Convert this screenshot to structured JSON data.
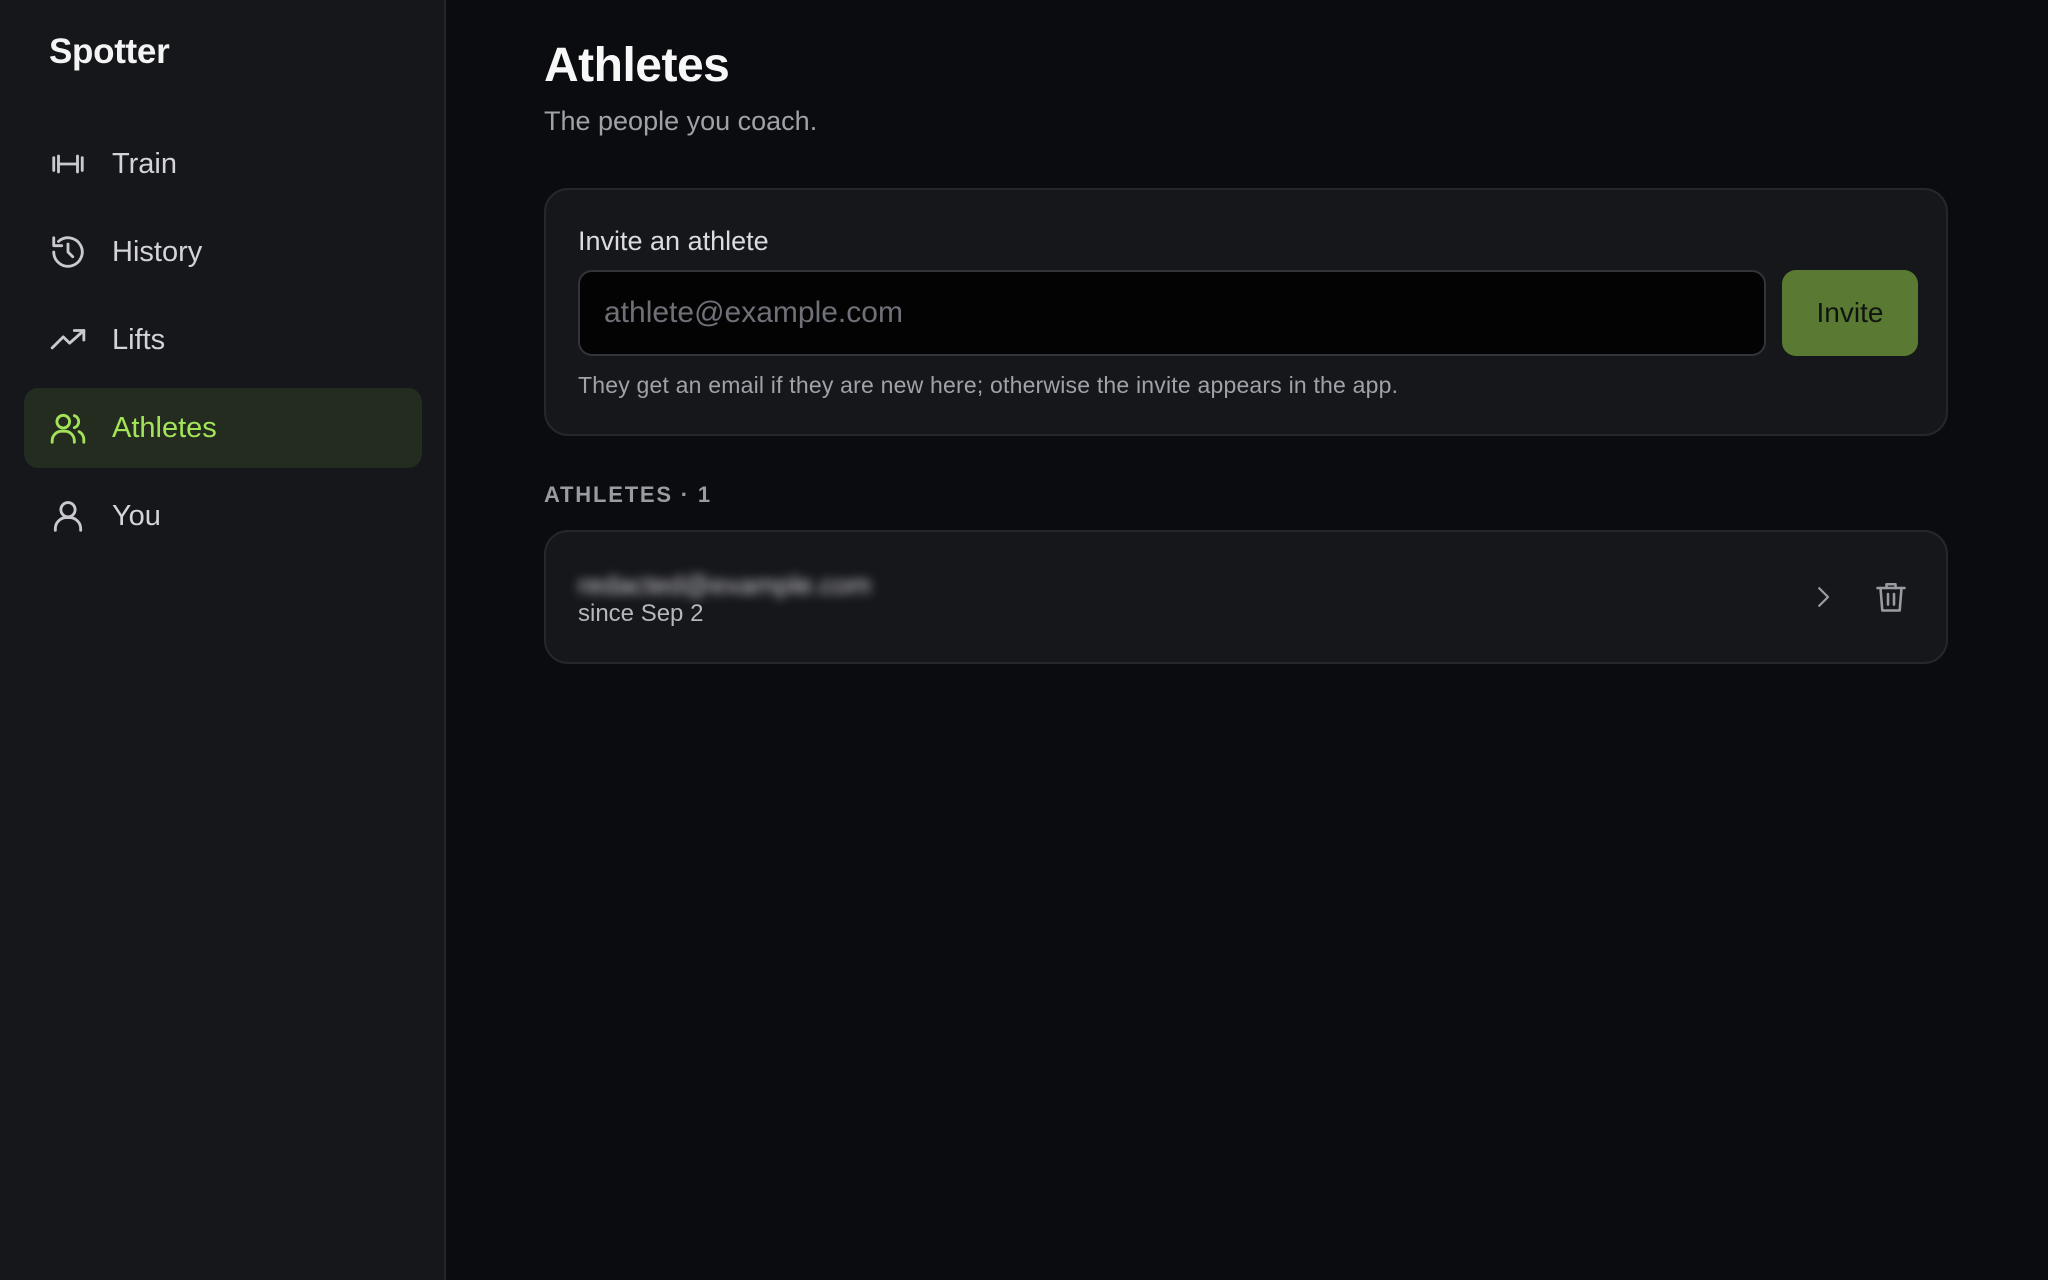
{
  "app": {
    "brand": "Spotter"
  },
  "sidebar": {
    "items": [
      {
        "label": "Train",
        "icon": "dumbbell-icon",
        "active": false
      },
      {
        "label": "History",
        "icon": "history-icon",
        "active": false
      },
      {
        "label": "Lifts",
        "icon": "trending-up-icon",
        "active": false
      },
      {
        "label": "Athletes",
        "icon": "users-icon",
        "active": true
      },
      {
        "label": "You",
        "icon": "user-icon",
        "active": false
      }
    ]
  },
  "page": {
    "title": "Athletes",
    "subtitle": "The people you coach."
  },
  "invite": {
    "label": "Invite an athlete",
    "placeholder": "athlete@example.com",
    "value": "",
    "button_label": "Invite",
    "hint": "They get an email if they are new here; otherwise the invite appears in the app."
  },
  "athletes": {
    "heading": "ATHLETES · 1",
    "rows": [
      {
        "name": "redacted@example.com",
        "since": "since Sep 2"
      }
    ]
  },
  "colors": {
    "accent": "#a3e35a",
    "accent_bg": "#232c1f",
    "button_bg": "#5a7a33",
    "background": "#0b0c0f",
    "surface": "#16171b"
  }
}
